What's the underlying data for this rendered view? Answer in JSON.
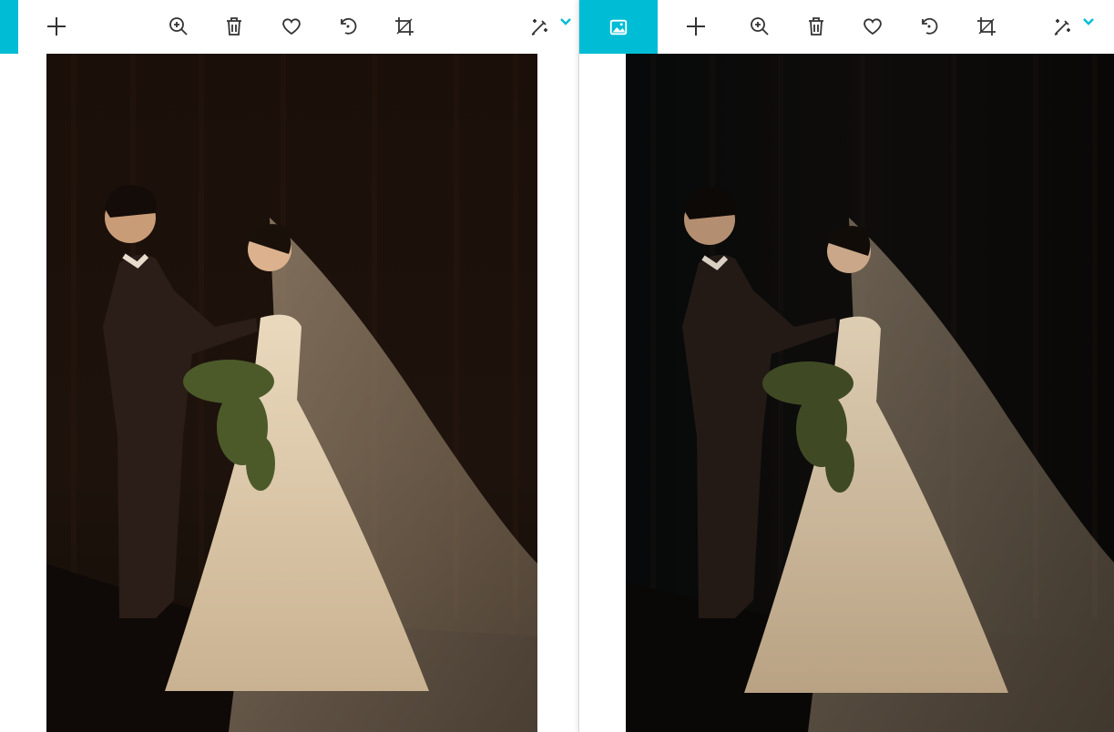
{
  "colors": {
    "accent": "#00bcd4",
    "icon": "#333333",
    "chevron": "#00bcd4",
    "photo_bg_left": "#1c120c",
    "photo_bg_right": "#0c0a09"
  },
  "left_pane": {
    "toolbar": {
      "icons": [
        "plus-icon",
        "zoom-in-icon",
        "trash-icon",
        "heart-icon",
        "rotate-icon",
        "crop-icon",
        "magic-edit-icon",
        "chevron-down-icon"
      ]
    },
    "photo": {
      "subject": "wedding-couple-photo"
    }
  },
  "right_pane": {
    "toolbar": {
      "active_tab_icon": "image-icon",
      "icons": [
        "plus-icon",
        "zoom-in-icon",
        "trash-icon",
        "heart-icon",
        "rotate-icon",
        "crop-icon",
        "magic-edit-icon",
        "chevron-down-icon"
      ]
    },
    "photo": {
      "subject": "wedding-couple-photo-edited"
    }
  }
}
